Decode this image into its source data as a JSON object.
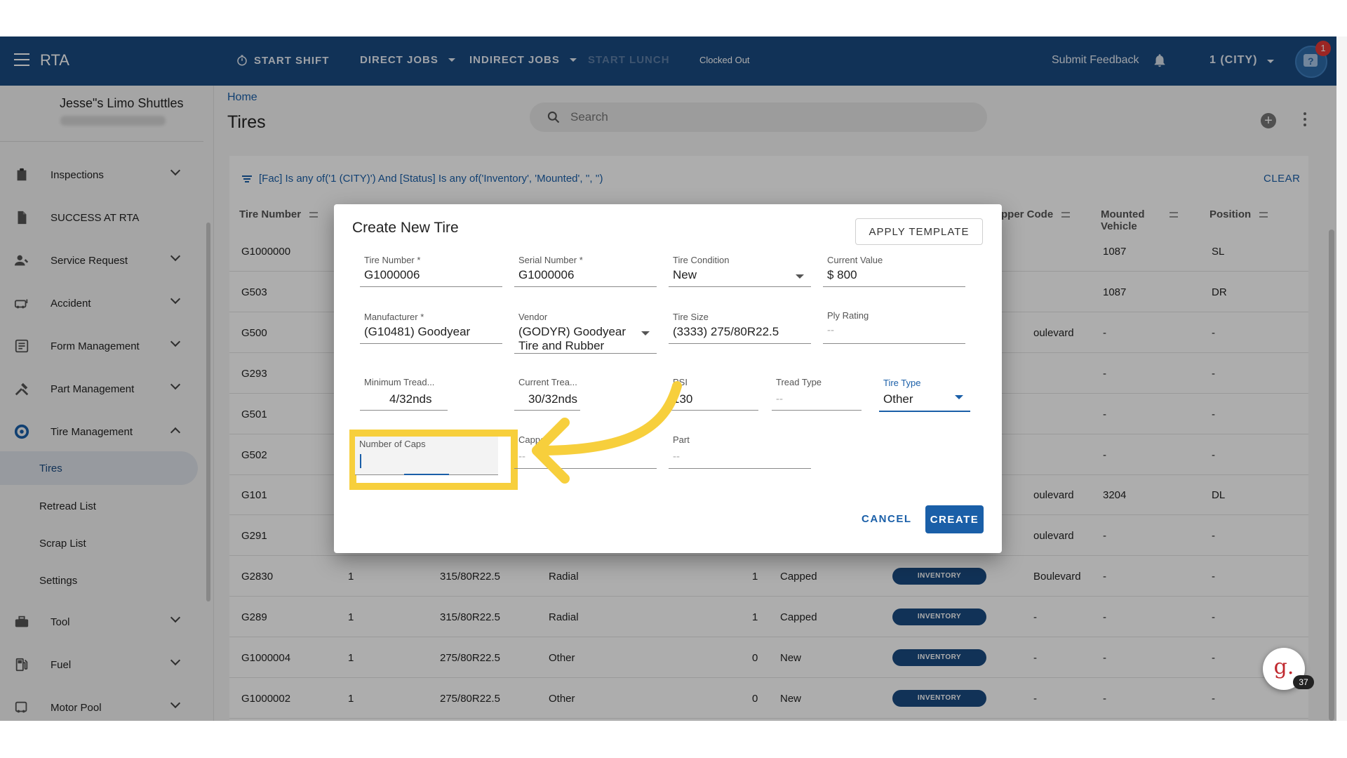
{
  "topbar": {
    "app_title": "RTA",
    "nav": {
      "start_shift": "START SHIFT",
      "direct_jobs": "DIRECT JOBS",
      "indirect_jobs": "INDIRECT JOBS",
      "start_lunch": "START LUNCH"
    },
    "clocked_status": "Clocked Out",
    "submit_feedback": "Submit Feedback",
    "location": "1 (CITY)",
    "notification_count": "1"
  },
  "sidebar": {
    "company": "Jesse\"s Limo Shuttles",
    "items": [
      {
        "label": "Inspections",
        "icon": "clipboard-icon"
      },
      {
        "label": "SUCCESS AT RTA",
        "icon": "document-icon"
      },
      {
        "label": "Service Request",
        "icon": "person-wrench-icon"
      },
      {
        "label": "Accident",
        "icon": "car-icon"
      },
      {
        "label": "Form Management",
        "icon": "form-icon"
      },
      {
        "label": "Part Management",
        "icon": "tools-icon"
      },
      {
        "label": "Tire Management",
        "icon": "tire-icon"
      }
    ],
    "sub_items": [
      "Tires",
      "Retread List",
      "Scrap List",
      "Settings"
    ],
    "items_after": [
      {
        "label": "Tool",
        "icon": "toolbox-icon"
      },
      {
        "label": "Fuel",
        "icon": "fuel-icon"
      },
      {
        "label": "Motor Pool",
        "icon": "bus-icon"
      }
    ]
  },
  "main": {
    "breadcrumb": "Home",
    "title": "Tires",
    "search_placeholder": "Search",
    "filter_text": "[Fac] Is any of('1 (CITY)') And [Status] Is any of('Inventory', 'Mounted', '', '')",
    "clear_label": "CLEAR",
    "columns": {
      "tire_number": "Tire Number",
      "capper_code": "pper Code",
      "mounted_vehicle": "Mounted Vehicle",
      "position": "Position"
    },
    "rows": [
      {
        "tire": "G1000000",
        "c2": "",
        "size": "",
        "type": "",
        "caps": "",
        "cond": "",
        "status": "",
        "loc": "",
        "vehicle": "1087",
        "pos": "SL"
      },
      {
        "tire": "G503",
        "c2": "",
        "size": "",
        "type": "",
        "caps": "",
        "cond": "",
        "status": "",
        "loc": "",
        "vehicle": "1087",
        "pos": "DR"
      },
      {
        "tire": "G500",
        "c2": "",
        "size": "",
        "type": "",
        "caps": "",
        "cond": "",
        "status": "",
        "loc": "oulevard",
        "vehicle": "-",
        "pos": "-"
      },
      {
        "tire": "G293",
        "c2": "",
        "size": "",
        "type": "",
        "caps": "",
        "cond": "",
        "status": "",
        "loc": "",
        "vehicle": "-",
        "pos": "-"
      },
      {
        "tire": "G501",
        "c2": "",
        "size": "",
        "type": "",
        "caps": "",
        "cond": "",
        "status": "",
        "loc": "",
        "vehicle": "-",
        "pos": "-"
      },
      {
        "tire": "G502",
        "c2": "",
        "size": "",
        "type": "",
        "caps": "",
        "cond": "",
        "status": "",
        "loc": "",
        "vehicle": "-",
        "pos": "-"
      },
      {
        "tire": "G101",
        "c2": "",
        "size": "",
        "type": "",
        "caps": "",
        "cond": "",
        "status": "",
        "loc": "oulevard",
        "vehicle": "3204",
        "pos": "DL"
      },
      {
        "tire": "G291",
        "c2": "",
        "size": "",
        "type": "",
        "caps": "",
        "cond": "",
        "status": "",
        "loc": "oulevard",
        "vehicle": "-",
        "pos": "-"
      },
      {
        "tire": "G2830",
        "c2": "1",
        "size": "315/80R22.5",
        "type": "Radial",
        "caps": "1",
        "cond": "Capped",
        "status": "INVENTORY",
        "loc": "Boulevard",
        "vehicle": "-",
        "pos": "-"
      },
      {
        "tire": "G289",
        "c2": "1",
        "size": "315/80R22.5",
        "type": "Radial",
        "caps": "1",
        "cond": "Capped",
        "status": "INVENTORY",
        "loc": "-",
        "vehicle": "-",
        "pos": "-"
      },
      {
        "tire": "G1000004",
        "c2": "1",
        "size": "275/80R22.5",
        "type": "Other",
        "caps": "0",
        "cond": "New",
        "status": "INVENTORY",
        "loc": "-",
        "vehicle": "-",
        "pos": "-"
      },
      {
        "tire": "G1000002",
        "c2": "1",
        "size": "275/80R22.5",
        "type": "Other",
        "caps": "0",
        "cond": "New",
        "status": "INVENTORY",
        "loc": "-",
        "vehicle": "-",
        "pos": "-"
      }
    ]
  },
  "dialog": {
    "title": "Create New Tire",
    "apply_template": "APPLY TEMPLATE",
    "fields": {
      "tire_number": {
        "label": "Tire Number *",
        "value": "G1000006"
      },
      "serial_number": {
        "label": "Serial Number *",
        "value": "G1000006"
      },
      "tire_condition": {
        "label": "Tire Condition",
        "value": "New"
      },
      "current_value": {
        "label": "Current Value",
        "value": "$ 800"
      },
      "manufacturer": {
        "label": "Manufacturer *",
        "value": "(G10481) Goodyear"
      },
      "vendor": {
        "label": "Vendor",
        "value_line1": "(GODYR) Goodyear",
        "value_line2": "Tire and Rubber"
      },
      "tire_size": {
        "label": "Tire Size",
        "value": "(3333) 275/80R22.5"
      },
      "ply_rating": {
        "label": "Ply Rating",
        "value": "--"
      },
      "min_tread": {
        "label": "Minimum Tread...",
        "value": "4/32nds"
      },
      "current_tread": {
        "label": "Current Trea...",
        "value": "30/32nds"
      },
      "psi": {
        "label": "PSI",
        "value": "130"
      },
      "tread_type": {
        "label": "Tread Type",
        "value": "--"
      },
      "tire_type": {
        "label": "Tire Type",
        "value": "Other"
      },
      "number_of_caps": {
        "label": "Number of Caps",
        "value": ""
      },
      "capper": {
        "label": "Capper",
        "value": "--"
      },
      "part": {
        "label": "Part",
        "value": "--"
      }
    },
    "cancel": "CANCEL",
    "create": "CREATE"
  },
  "help_widget": {
    "glyph": "g.",
    "count": "37"
  },
  "colors": {
    "primary": "#1a4a80",
    "accent": "#1a5fa8",
    "highlight": "#f7cf3c"
  }
}
